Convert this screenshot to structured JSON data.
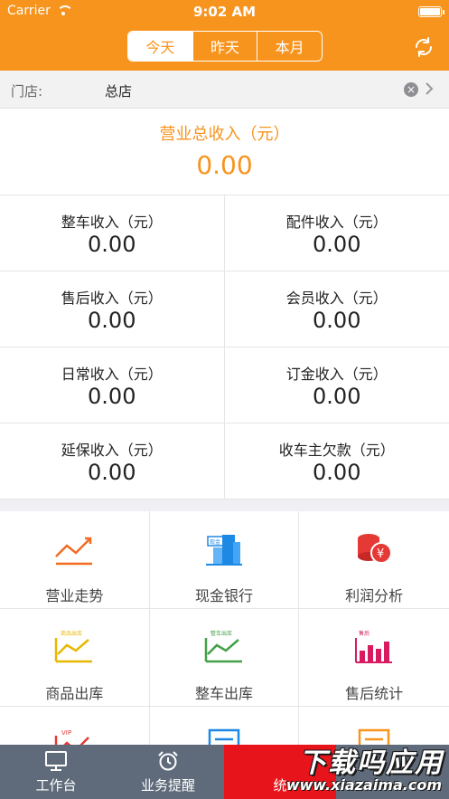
{
  "status_bar": {
    "carrier": "Carrier",
    "time": "9:02 AM"
  },
  "header": {
    "tabs": [
      {
        "label": "今天",
        "active": true
      },
      {
        "label": "昨天",
        "active": false
      },
      {
        "label": "本月",
        "active": false
      }
    ],
    "accent_color": "#f7941d"
  },
  "store": {
    "label": "门店:",
    "value": "总店"
  },
  "total": {
    "label": "营业总收入（元）",
    "value": "0.00"
  },
  "income": [
    {
      "label": "整车收入（元）",
      "value": "0.00"
    },
    {
      "label": "配件收入（元）",
      "value": "0.00"
    },
    {
      "label": "售后收入（元）",
      "value": "0.00"
    },
    {
      "label": "会员收入（元）",
      "value": "0.00"
    },
    {
      "label": "日常收入（元）",
      "value": "0.00"
    },
    {
      "label": "订金收入（元）",
      "value": "0.00"
    },
    {
      "label": "延保收入（元）",
      "value": "0.00"
    },
    {
      "label": "收车主欠款（元）",
      "value": "0.00"
    }
  ],
  "functions": [
    {
      "label": "营业走势",
      "icon": "trend-icon"
    },
    {
      "label": "现金银行",
      "icon": "bank-icon",
      "icon_text": "现金"
    },
    {
      "label": "利润分析",
      "icon": "profit-icon"
    },
    {
      "label": "商品出库",
      "icon": "goods-out-icon",
      "icon_text": "商品出库"
    },
    {
      "label": "整车出库",
      "icon": "car-out-icon",
      "icon_text": "整车出库"
    },
    {
      "label": "售后统计",
      "icon": "aftersale-icon",
      "icon_text": "售后"
    },
    {
      "label": "",
      "icon": "vip-icon",
      "icon_text": "VIP"
    },
    {
      "label": "",
      "icon": "document-blue-icon"
    },
    {
      "label": "",
      "icon": "document-orange-icon"
    }
  ],
  "tabbar": [
    {
      "label": "工作台",
      "icon": "monitor-icon",
      "active": false
    },
    {
      "label": "业务提醒",
      "icon": "alarm-clock-icon",
      "active": false
    },
    {
      "label": "统",
      "icon": "",
      "active": true
    }
  ],
  "watermark": {
    "top": "下载吗应用",
    "bottom": "www.xiazaima.com"
  }
}
